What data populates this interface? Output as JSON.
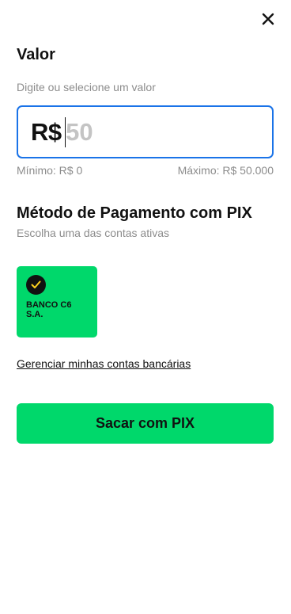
{
  "header": {
    "close_icon": "close-icon"
  },
  "amount": {
    "title": "Valor",
    "hint": "Digite ou selecione um valor",
    "currency": "R$",
    "placeholder": "50",
    "value": "",
    "min_label": "Mínimo: R$ 0",
    "max_label": "Máximo: R$ 50.000",
    "border_color": "#1a73e8"
  },
  "payment": {
    "title": "Método de Pagamento com PIX",
    "subtitle": "Escolha uma das contas ativas",
    "accounts": [
      {
        "name": "BANCO C6 S.A.",
        "selected": true,
        "icon": "check-icon"
      }
    ],
    "manage_link": "Gerenciar minhas contas bancárias"
  },
  "actions": {
    "submit_label": "Sacar com PIX"
  },
  "colors": {
    "accent_green": "#00d86b",
    "text": "#111111",
    "muted": "#8c8c8c"
  }
}
